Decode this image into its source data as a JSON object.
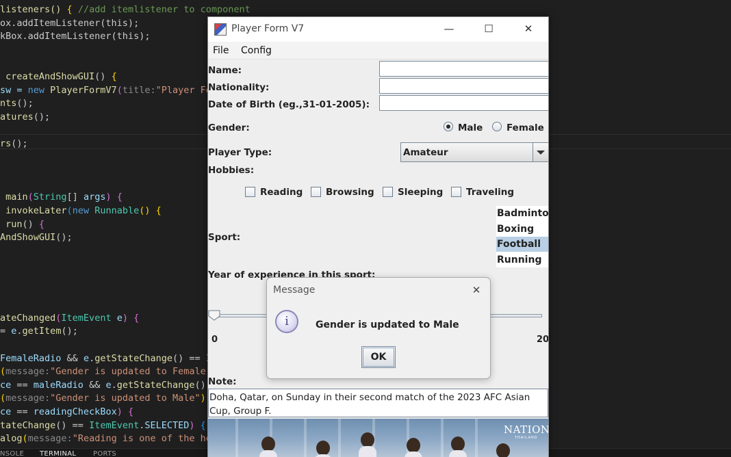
{
  "editor": {
    "lines": [
      [
        [
          "listeners() ",
          "fn"
        ],
        [
          "{ ",
          "br1"
        ],
        [
          "//add itemlistener to component",
          "cm"
        ]
      ],
      [
        [
          "ox.addItemListener(this);",
          "plain"
        ]
      ],
      [
        [
          "kBox.addItemListener(this);",
          "plain"
        ]
      ],
      [],
      [],
      [
        [
          " createAndShowGUI",
          "fn"
        ],
        [
          "() ",
          "plain"
        ],
        [
          "{",
          "br1"
        ]
      ],
      [
        [
          "sw = ",
          "var"
        ],
        [
          "new ",
          "kw"
        ],
        [
          "PlayerFormV7",
          "fn"
        ],
        [
          "(",
          "br2"
        ],
        [
          "title:",
          "hint"
        ],
        [
          "\"Player Fo",
          "str"
        ]
      ],
      [
        [
          "nts",
          "fn"
        ],
        [
          "();",
          "plain"
        ]
      ],
      [
        [
          "atures",
          "fn"
        ],
        [
          "();",
          "plain"
        ]
      ],
      [],
      [
        [
          "rs",
          "fn"
        ],
        [
          "();",
          "plain"
        ]
      ],
      [],
      [],
      [],
      [
        [
          " main",
          "fn"
        ],
        [
          "(",
          "br2"
        ],
        [
          "String",
          "type"
        ],
        [
          "[] ",
          "plain"
        ],
        [
          "args",
          "var"
        ],
        [
          ") ",
          "br2"
        ],
        [
          "{",
          "br2"
        ]
      ],
      [
        [
          " invokeLater",
          "fn"
        ],
        [
          "(",
          "br3"
        ],
        [
          "new ",
          "kw"
        ],
        [
          "Runnable",
          "type"
        ],
        [
          "() ",
          "br1"
        ],
        [
          "{",
          "br1"
        ]
      ],
      [
        [
          " run",
          "fn"
        ],
        [
          "() ",
          "plain"
        ],
        [
          "{",
          "br2"
        ]
      ],
      [
        [
          "AndShowGUI",
          "fn"
        ],
        [
          "();",
          "plain"
        ]
      ],
      [],
      [],
      [],
      [],
      [],
      [
        [
          "ateChanged",
          "fn"
        ],
        [
          "(",
          "br2"
        ],
        [
          "ItemEvent ",
          "type"
        ],
        [
          "e",
          "var"
        ],
        [
          ") ",
          "br2"
        ],
        [
          "{",
          "br2"
        ]
      ],
      [
        [
          "= ",
          "plain"
        ],
        [
          "e",
          "var"
        ],
        [
          ".",
          "plain"
        ],
        [
          "getItem",
          "fn"
        ],
        [
          "();",
          "plain"
        ]
      ],
      [],
      [
        [
          "FemaleRadio ",
          "var"
        ],
        [
          "&& ",
          "plain"
        ],
        [
          "e",
          "var"
        ],
        [
          ".",
          "plain"
        ],
        [
          "getStateChange",
          "fn"
        ],
        [
          "() == It",
          "plain"
        ]
      ],
      [
        [
          "(",
          "br1"
        ],
        [
          "message:",
          "hint"
        ],
        [
          "\"Gender is updated to Female\"",
          "str"
        ],
        [
          ")",
          "br1"
        ]
      ],
      [
        [
          "ce ",
          "var"
        ],
        [
          "== ",
          "plain"
        ],
        [
          "maleRadio ",
          "var"
        ],
        [
          "&& ",
          "plain"
        ],
        [
          "e",
          "var"
        ],
        [
          ".",
          "plain"
        ],
        [
          "getStateChange",
          "fn"
        ],
        [
          "()",
          "plain"
        ]
      ],
      [
        [
          "(",
          "br1"
        ],
        [
          "message:",
          "hint"
        ],
        [
          "\"Gender is updated to Male\"",
          "str"
        ],
        [
          ");",
          "br1"
        ]
      ],
      [
        [
          "ce ",
          "var"
        ],
        [
          "== ",
          "plain"
        ],
        [
          "readingCheckBox",
          "var"
        ],
        [
          ") ",
          "br2"
        ],
        [
          "{",
          "br2"
        ]
      ],
      [
        [
          "tateChange",
          "fn"
        ],
        [
          "() == ",
          "plain"
        ],
        [
          "ItemEvent",
          "type"
        ],
        [
          ".",
          "plain"
        ],
        [
          "SELECTED",
          "var"
        ],
        [
          ") ",
          "br2"
        ],
        [
          "{",
          "br3"
        ]
      ],
      [
        [
          "alog",
          "fn"
        ],
        [
          "(",
          "br1"
        ],
        [
          "message:",
          "hint"
        ],
        [
          "\"Reading is one of the hob",
          "str"
        ]
      ]
    ]
  },
  "panel": {
    "tabs": [
      "NSOLE",
      "TERMINAL",
      "PORTS"
    ],
    "active_tab": "TERMINAL"
  },
  "window": {
    "title": "Player Form V7",
    "controls": {
      "minimize": "—",
      "maximize": "☐",
      "close": "✕"
    },
    "menu": [
      "File",
      "Config"
    ],
    "labels": {
      "name": "Name:",
      "nationality": "Nationality:",
      "dob": "Date of Birth (eg.,31-01-2005):",
      "gender": "Gender:",
      "player_type": "Player Type:",
      "hobbies": "Hobbies:",
      "sport": "Sport:",
      "experience": "Year of experience in this sport:",
      "note": "Note:"
    },
    "fields": {
      "name": "",
      "nationality": "",
      "dob": ""
    },
    "gender": {
      "options": [
        "Male",
        "Female"
      ],
      "selected": "Male"
    },
    "player_type": {
      "selected": "Amateur"
    },
    "hobbies": [
      {
        "label": "Reading",
        "checked": false
      },
      {
        "label": "Browsing",
        "checked": false
      },
      {
        "label": "Sleeping",
        "checked": false
      },
      {
        "label": "Traveling",
        "checked": false
      }
    ],
    "sports": {
      "items": [
        "Badminton",
        "Boxing",
        "Football",
        "Running"
      ],
      "selected": "Football"
    },
    "experience": {
      "min": "0",
      "max": "20",
      "value": 0
    },
    "note_text": "Doha, Qatar, on Sunday in their second match of the 2023 AFC Asian Cup, Group F.",
    "photo": {
      "brand": "NATION",
      "brand_sub": "THAILAND"
    }
  },
  "dialog": {
    "title": "Message",
    "close": "✕",
    "icon": "i",
    "message": "Gender is updated to Male",
    "ok_label": "OK"
  },
  "colors": {
    "editor_bg": "#1f1f1f",
    "list_selection": "#b8cfe5",
    "window_bg": "#eeeeee"
  }
}
